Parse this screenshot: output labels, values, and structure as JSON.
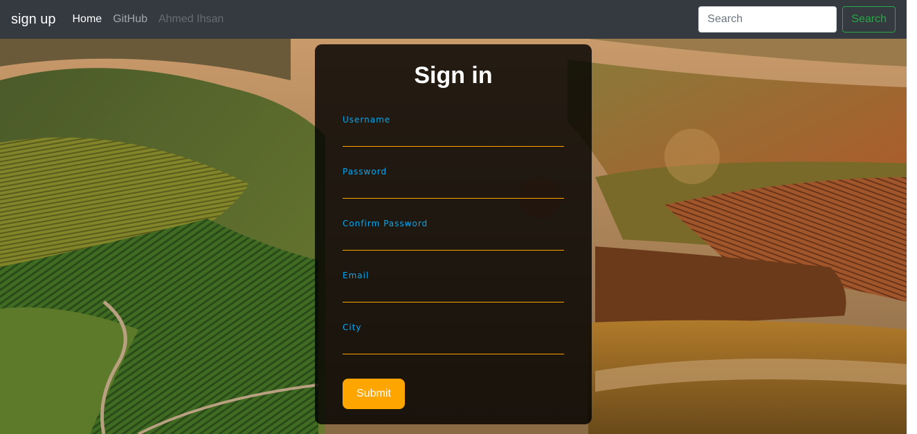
{
  "navbar": {
    "brand": "sign up",
    "links": [
      {
        "label": "Home",
        "state": "active"
      },
      {
        "label": "GitHub",
        "state": "normal"
      },
      {
        "label": "Ahmed Ihsan",
        "state": "disabled"
      }
    ],
    "search": {
      "placeholder": "Search",
      "value": "",
      "button_label": "Search"
    }
  },
  "form": {
    "title": "Sign in",
    "fields": [
      {
        "label": "Username",
        "value": ""
      },
      {
        "label": "Password",
        "value": ""
      },
      {
        "label": "Confirm Password",
        "value": ""
      },
      {
        "label": "Email",
        "value": ""
      },
      {
        "label": "City",
        "value": ""
      }
    ],
    "submit_label": "Submit"
  },
  "colors": {
    "navbar_bg": "#343a40",
    "label_blue": "#03a9f4",
    "underline_orange": "#ffa500",
    "submit_orange": "#ffa500",
    "search_green": "#28a745"
  },
  "background_image": "vineyard-landscape"
}
